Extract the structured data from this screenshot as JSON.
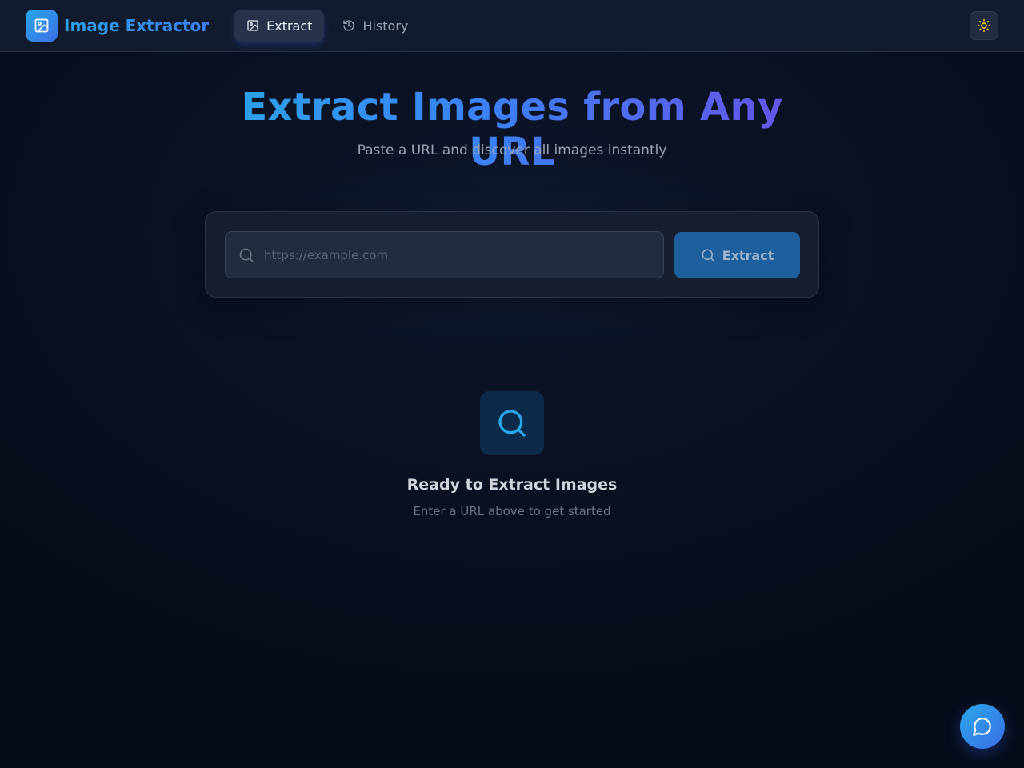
{
  "app": {
    "title": "Image Extractor",
    "accent": "#2aa7e8",
    "accent_secondary": "#6a4fe6"
  },
  "nav": {
    "items": [
      {
        "label": "Extract",
        "icon": "image-icon",
        "active": true
      },
      {
        "label": "History",
        "icon": "history-icon",
        "active": false
      }
    ]
  },
  "header": {
    "theme_toggle_icon": "sun-icon"
  },
  "hero": {
    "title": "Extract Images from Any URL",
    "subtitle": "Paste a URL and discover all images instantly"
  },
  "search": {
    "placeholder": "https://example.com",
    "value": "",
    "button_label": "Extract",
    "icon": "search-icon"
  },
  "empty_state": {
    "icon": "search-icon",
    "title": "Ready to Extract Images",
    "subtitle": "Enter a URL above to get started"
  },
  "chat": {
    "icon": "chat-bubble-icon"
  }
}
